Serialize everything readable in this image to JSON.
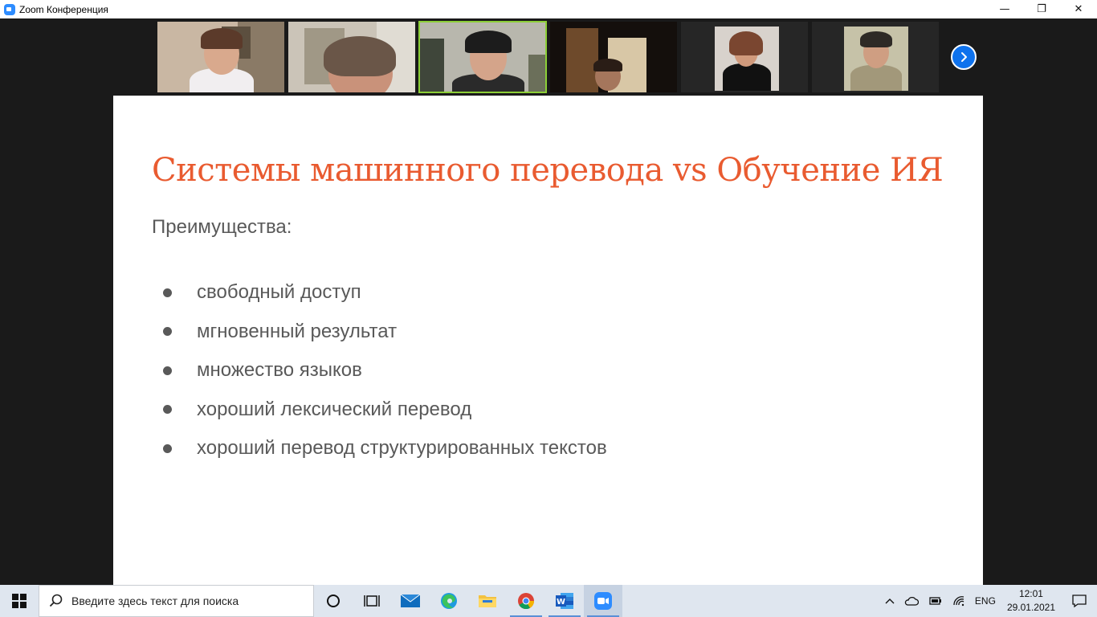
{
  "window": {
    "title": "Zoom Конференция",
    "minimize": "—",
    "restore": "❐",
    "close": "✕"
  },
  "gallery": {
    "participants": [
      {
        "id": "p1",
        "active": false
      },
      {
        "id": "p2",
        "active": false
      },
      {
        "id": "p3",
        "active": true
      },
      {
        "id": "p4",
        "active": false
      },
      {
        "id": "p5",
        "active": false
      },
      {
        "id": "p6",
        "active": false
      }
    ],
    "next_icon": "chevron-right-icon"
  },
  "slide": {
    "title": "Системы машинного перевода vs Обучение ИЯ",
    "subtitle": "Преимущества:",
    "bullets": [
      "свободный доступ",
      "мгновенный результат",
      "множество языков",
      "хороший лексический перевод",
      "хороший перевод структурированных текстов"
    ]
  },
  "taskbar": {
    "search_placeholder": "Введите здесь текст для поиска",
    "language": "ENG",
    "time": "12:01",
    "date": "29.01.2021"
  },
  "colors": {
    "title_accent": "#e95b30",
    "body_text": "#595959",
    "active_speaker": "#8ccf37",
    "zoom_blue": "#0e72ed"
  }
}
